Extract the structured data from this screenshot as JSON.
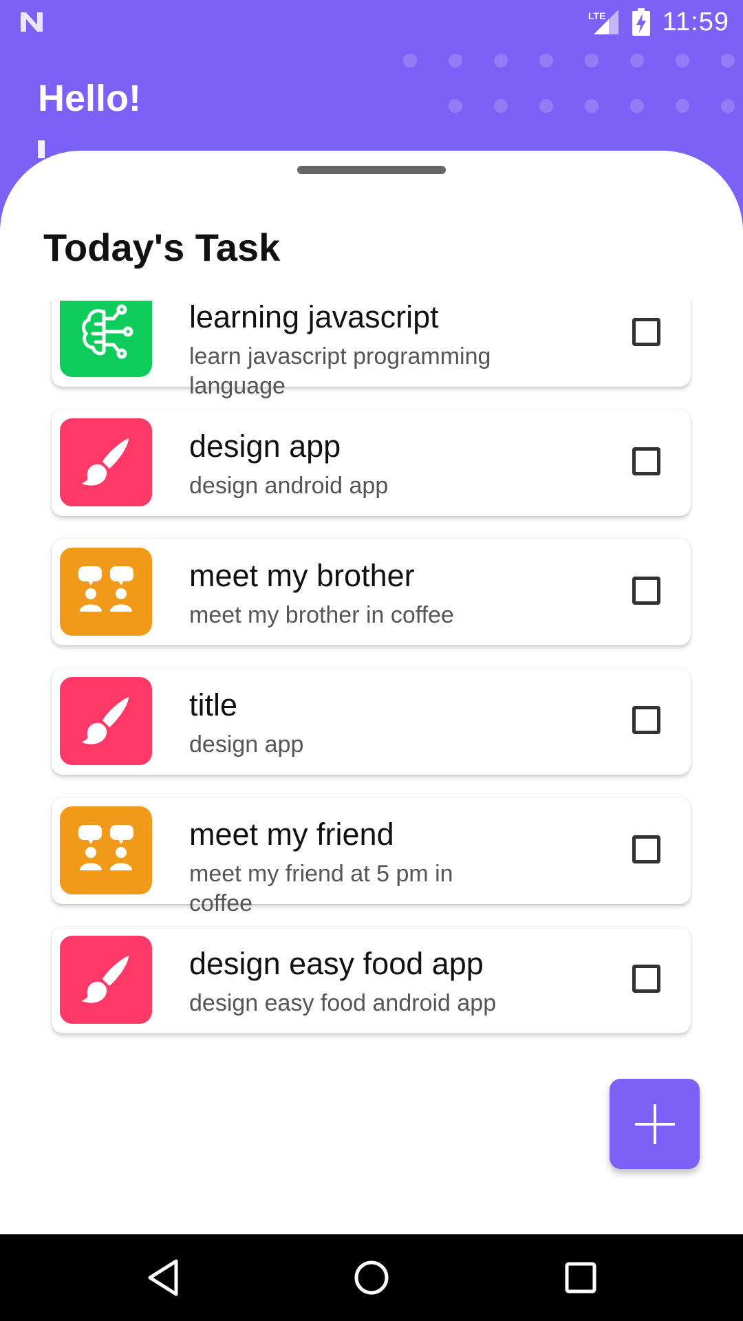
{
  "status_bar": {
    "time": "11:59",
    "network": "LTE",
    "icons": [
      "notification-n-icon",
      "lte-signal-icon",
      "battery-charging-icon"
    ]
  },
  "header": {
    "greeting": "Hello!"
  },
  "section": {
    "title": "Today's Task"
  },
  "colors": {
    "primary": "#7b61f5",
    "green": "#0dcc5b",
    "pink": "#fd3a67",
    "orange": "#f19a1a"
  },
  "tasks": [
    {
      "title": "learning javascript",
      "desc": "learn javascript programming language",
      "icon": "brain-circuit-icon",
      "color": "#0dcc5b"
    },
    {
      "title": "design app",
      "desc": "design android app",
      "icon": "paint-brush-icon",
      "color": "#fd3a67"
    },
    {
      "title": "meet my brother",
      "desc": "meet my brother in coffee",
      "icon": "people-chat-icon",
      "color": "#f19a1a"
    },
    {
      "title": "title",
      "desc": "design app",
      "icon": "paint-brush-icon",
      "color": "#fd3a67"
    },
    {
      "title": "meet my friend",
      "desc": "meet my friend at 5 pm in coffee",
      "icon": "people-chat-icon",
      "color": "#f19a1a"
    },
    {
      "title": "design easy food app",
      "desc": "design easy food android app",
      "icon": "paint-brush-icon",
      "color": "#fd3a67"
    }
  ],
  "fab": {
    "icon": "plus-icon"
  },
  "nav": {
    "buttons": [
      "back-icon",
      "home-icon",
      "recents-icon"
    ]
  }
}
